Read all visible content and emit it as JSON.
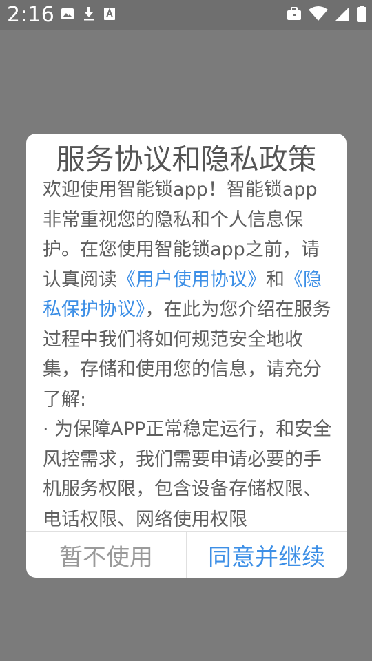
{
  "status_bar": {
    "time": "2:16",
    "icons_left": [
      "image-icon",
      "download-icon",
      "a-icon"
    ],
    "icons_right": [
      "briefcase-icon",
      "wifi-icon",
      "signal-icon",
      "battery-icon"
    ]
  },
  "dialog": {
    "title": "服务协议和隐私政策",
    "intro_text": "欢迎使用智能锁app！智能锁app非常重视您的隐私和个人信息保护。在您使用智能锁app之前，请认真阅读",
    "user_agreement_link": "《用户使用协议》",
    "and_text": "和",
    "privacy_policy_link": "《隐私保护协议》",
    "after_links_text": "，在此为您介绍在服务过程中我们将如何规范安全地收集，存储和使用您的信息，请充分了解:",
    "bullet_text": "· 为保障APP正常稳定运行，和安全风控需求，我们需要申请必要的手机服务权限，包含设备存储权限、电话权限、网络使用权限",
    "decline_button": "暂不使用",
    "agree_button": "同意并继续"
  },
  "colors": {
    "overlay": "#7b7b7b",
    "status_bar": "#6f6f6f",
    "link": "#3d8fe6",
    "body_text": "#5f5f5f",
    "decline_text": "#9a9a9a"
  }
}
